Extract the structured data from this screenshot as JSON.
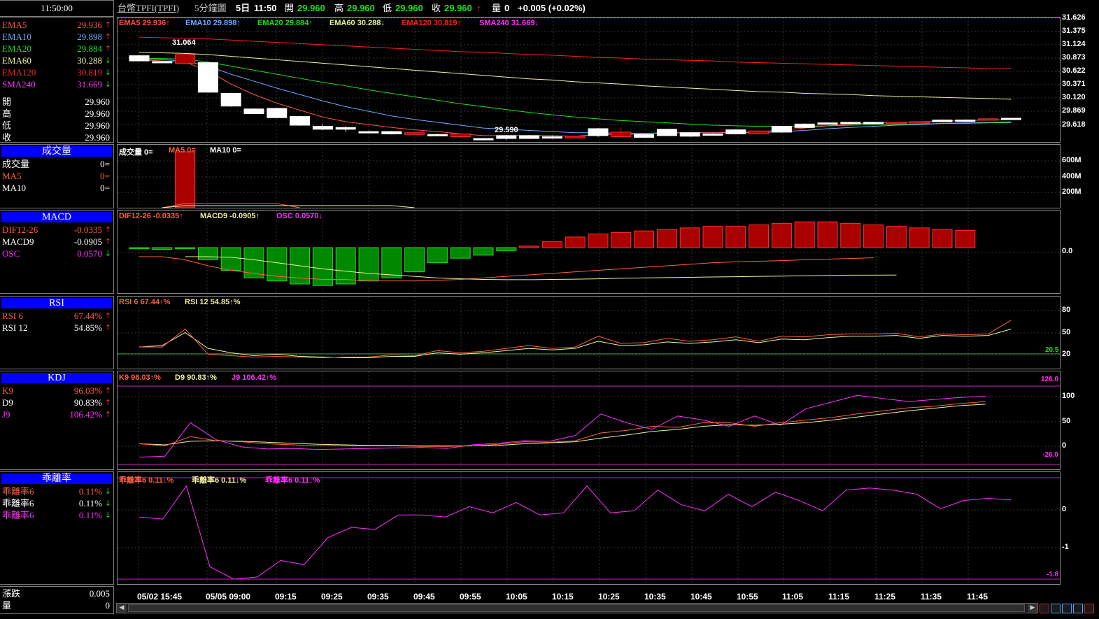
{
  "clock": "11:50:00",
  "top": {
    "symbol": "台幣TPFI(TPFI)",
    "interval": "5分鐘圖",
    "day": "5日",
    "time": "11:50",
    "open_label": "開",
    "open": "29.960",
    "high_label": "高",
    "high": "29.960",
    "low_label": "低",
    "low": "29.960",
    "close_label": "收",
    "close": "29.960",
    "close_arrow": "↑",
    "vol_label": "量",
    "vol": "0",
    "change": "+0.005 (+0.02%)"
  },
  "side": {
    "ema": [
      {
        "label": "EMA5",
        "value": "29.936",
        "arrow": "↑",
        "color": "#ff5050",
        "arrow_color": "#ff3030"
      },
      {
        "label": "EMA10",
        "value": "29.898",
        "arrow": "↑",
        "color": "#6fa8ff",
        "arrow_color": "#ff3030"
      },
      {
        "label": "EMA20",
        "value": "29.884",
        "arrow": "↑",
        "color": "#22dd22",
        "arrow_color": "#ff3030"
      },
      {
        "label": "EMA60",
        "value": "30.288",
        "arrow": "↓",
        "color": "#f0f0a0",
        "arrow_color": "#22dd22"
      },
      {
        "label": "EMA120",
        "value": "30.819",
        "arrow": "↓",
        "color": "#ff2020",
        "arrow_color": "#22dd22"
      },
      {
        "label": "SMA240",
        "value": "31.669",
        "arrow": "↓",
        "color": "#ff30ff",
        "arrow_color": "#22dd22"
      }
    ],
    "ohlc": [
      {
        "label": "開",
        "value": "29.960"
      },
      {
        "label": "高",
        "value": "29.960"
      },
      {
        "label": "低",
        "value": "29.960"
      },
      {
        "label": "收",
        "value": "29.960"
      }
    ],
    "vol_title": "成交量",
    "vol_rows": [
      {
        "label": "成交量",
        "value": "0=",
        "color": "#ffffff"
      },
      {
        "label": "MA5",
        "value": "0=",
        "color": "#ff6040"
      },
      {
        "label": "MA10",
        "value": "0=",
        "color": "#ffffff"
      }
    ],
    "macd_title": "MACD",
    "macd_rows": [
      {
        "label": "DIF12-26",
        "value": "-0.0335",
        "arrow": "↑",
        "color": "#ff6040",
        "arrow_color": "#ff3030"
      },
      {
        "label": "MACD9",
        "value": "-0.0905",
        "arrow": "↑",
        "color": "#ffffff",
        "arrow_color": "#ff3030"
      },
      {
        "label": "OSC",
        "value": "0.0570",
        "arrow": "↓",
        "color": "#ff30ff",
        "arrow_color": "#22dd22"
      }
    ],
    "rsi_title": "RSI",
    "rsi_rows": [
      {
        "label": "RSI 6",
        "value": "67.44%",
        "arrow": "↑",
        "color": "#ff6040",
        "arrow_color": "#ff3030"
      },
      {
        "label": "RSI 12",
        "value": "54.85%",
        "arrow": "↑",
        "color": "#ffffff",
        "arrow_color": "#ff3030"
      }
    ],
    "kdj_title": "KDJ",
    "kdj_rows": [
      {
        "label": "K9",
        "value": "96.03%",
        "arrow": "↑",
        "color": "#ff6040",
        "arrow_color": "#ff3030"
      },
      {
        "label": "D9",
        "value": "90.83%",
        "arrow": "↑",
        "color": "#ffffff",
        "arrow_color": "#ff3030"
      },
      {
        "label": "J9",
        "value": "106.42%",
        "arrow": "↑",
        "color": "#ff30ff",
        "arrow_color": "#ff3030"
      }
    ],
    "bias_title": "乖離率",
    "bias_rows": [
      {
        "label": "乖離率6",
        "value": "0.11%",
        "arrow": "↓",
        "color": "#ff6040",
        "arrow_color": "#22dd22"
      },
      {
        "label": "乖離率6",
        "value": "0.11%",
        "arrow": "↓",
        "color": "#ffffff",
        "arrow_color": "#22dd22"
      },
      {
        "label": "乖離率6",
        "value": "0.11%",
        "arrow": "↓",
        "color": "#ff30ff",
        "arrow_color": "#22dd22"
      }
    ],
    "bottom_rows": [
      {
        "label": "漲跌",
        "value": "0.005"
      },
      {
        "label": "量",
        "value": "0"
      }
    ]
  },
  "legends": {
    "price": [
      {
        "text": "EMA5 29.936↑",
        "color": "#ff5050"
      },
      {
        "text": "EMA10 29.898↑",
        "color": "#6fa8ff"
      },
      {
        "text": "EMA20 29.884↑",
        "color": "#22dd22"
      },
      {
        "text": "EMA60 30.288↓",
        "color": "#f0f0a0"
      },
      {
        "text": "EMA120 30.819↑",
        "color": "#ff2020"
      },
      {
        "text": "SMA240 31.669↓",
        "color": "#ff30ff"
      }
    ],
    "volume": [
      {
        "text": "成交量 0=",
        "color": "#ffffff"
      },
      {
        "text": "MA5 0=",
        "color": "#ff6040"
      },
      {
        "text": "MA10 0=",
        "color": "#ffffff"
      }
    ],
    "macd": [
      {
        "text": "DIF12-26 -0.0335↑",
        "color": "#ff6040"
      },
      {
        "text": "MACD9 -0.0905↑",
        "color": "#f0f0a0"
      },
      {
        "text": "OSC 0.0570↓",
        "color": "#ff30ff"
      }
    ],
    "rsi": [
      {
        "text": "RSI 6 67.44↑%",
        "color": "#ff6040"
      },
      {
        "text": "RSI 12 54.85↑%",
        "color": "#f0f0a0"
      }
    ],
    "kdj": [
      {
        "text": "K9 96.03↑%",
        "color": "#ff6040"
      },
      {
        "text": "D9 90.83↑%",
        "color": "#f0f0a0"
      },
      {
        "text": "J9 106.42↑%",
        "color": "#ff30ff"
      }
    ],
    "bias": [
      {
        "text": "乖離率6 0.11↓%",
        "color": "#ff6040"
      },
      {
        "text": "乖離率6 0.11↓%",
        "color": "#f0f0a0"
      },
      {
        "text": "乖離率6 0.11↓%",
        "color": "#ff30ff"
      }
    ]
  },
  "scales": {
    "price": [
      "31.626",
      "31.375",
      "31.124",
      "30.873",
      "30.622",
      "30.371",
      "30.120",
      "29.869",
      "29.618"
    ],
    "volume": [
      "600M",
      "400M",
      "200M"
    ],
    "macd": [
      "0.0"
    ],
    "rsi": [
      "80",
      "50",
      "20"
    ],
    "rsi_ref": "20.5",
    "kdj": [
      "100",
      "50",
      "0"
    ],
    "kdj_hi": "126.0",
    "kdj_lo": "-26.0",
    "bias": [
      "0",
      "-1"
    ],
    "bias_lo": "-1.8"
  },
  "annotations": {
    "high": "31.064",
    "low": "29.590"
  },
  "xaxis": [
    "05/02 15:45",
    "05/05 09:00",
    "09:15",
    "09:25",
    "09:35",
    "09:45",
    "09:55",
    "10:05",
    "10:15",
    "10:25",
    "10:35",
    "10:45",
    "10:55",
    "11:05",
    "11:15",
    "11:25",
    "11:35",
    "11:45"
  ],
  "chart_data": {
    "type": "candlestick",
    "price_range": [
      29.55,
      31.7
    ],
    "candles": [
      {
        "o": 30.95,
        "c": 31.04,
        "h": 31.05,
        "l": 30.95
      },
      {
        "o": 30.93,
        "c": 30.94,
        "h": 30.95,
        "l": 30.92
      },
      {
        "o": 31.06,
        "c": 30.91,
        "h": 31.064,
        "l": 30.89
      },
      {
        "o": 30.41,
        "c": 30.92,
        "h": 30.93,
        "l": 30.4
      },
      {
        "o": 30.17,
        "c": 30.39,
        "h": 30.4,
        "l": 30.16
      },
      {
        "o": 30.04,
        "c": 30.12,
        "h": 30.13,
        "l": 30.03
      },
      {
        "o": 29.97,
        "c": 30.13,
        "h": 30.14,
        "l": 29.96
      },
      {
        "o": 29.84,
        "c": 29.99,
        "h": 30.0,
        "l": 29.83
      },
      {
        "o": 29.77,
        "c": 29.82,
        "h": 29.85,
        "l": 29.76
      },
      {
        "o": 29.77,
        "c": 29.8,
        "h": 29.82,
        "l": 29.73
      },
      {
        "o": 29.71,
        "c": 29.73,
        "h": 29.74,
        "l": 29.7
      },
      {
        "o": 29.69,
        "c": 29.73,
        "h": 29.74,
        "l": 29.68
      },
      {
        "o": 29.71,
        "c": 29.68,
        "h": 29.73,
        "l": 29.67
      },
      {
        "o": 29.66,
        "c": 29.68,
        "h": 29.69,
        "l": 29.65
      },
      {
        "o": 29.69,
        "c": 29.64,
        "h": 29.7,
        "l": 29.63
      },
      {
        "o": 29.6,
        "c": 29.61,
        "h": 29.62,
        "l": 29.59
      },
      {
        "o": 29.61,
        "c": 29.66,
        "h": 29.67,
        "l": 29.59
      },
      {
        "o": 29.61,
        "c": 29.66,
        "h": 29.67,
        "l": 29.6
      },
      {
        "o": 29.63,
        "c": 29.64,
        "h": 29.66,
        "l": 29.6
      },
      {
        "o": 29.65,
        "c": 29.62,
        "h": 29.66,
        "l": 29.61
      },
      {
        "o": 29.66,
        "c": 29.78,
        "h": 29.79,
        "l": 29.64
      },
      {
        "o": 29.72,
        "c": 29.64,
        "h": 29.8,
        "l": 29.63
      },
      {
        "o": 29.63,
        "c": 29.68,
        "h": 29.7,
        "l": 29.62
      },
      {
        "o": 29.66,
        "c": 29.77,
        "h": 29.78,
        "l": 29.65
      },
      {
        "o": 29.65,
        "c": 29.71,
        "h": 29.72,
        "l": 29.64
      },
      {
        "o": 29.68,
        "c": 29.69,
        "h": 29.7,
        "l": 29.67
      },
      {
        "o": 29.69,
        "c": 29.76,
        "h": 29.77,
        "l": 29.68
      },
      {
        "o": 29.74,
        "c": 29.69,
        "h": 29.75,
        "l": 29.68
      },
      {
        "o": 29.72,
        "c": 29.82,
        "h": 29.83,
        "l": 29.71
      },
      {
        "o": 29.8,
        "c": 29.86,
        "h": 29.87,
        "l": 29.79
      },
      {
        "o": 29.86,
        "c": 29.88,
        "h": 29.89,
        "l": 29.85
      },
      {
        "o": 29.87,
        "c": 29.89,
        "h": 29.9,
        "l": 29.86
      },
      {
        "o": 29.89,
        "c": 29.89,
        "h": 29.9,
        "l": 29.88
      },
      {
        "o": 29.89,
        "c": 29.88,
        "h": 29.9,
        "l": 29.87
      },
      {
        "o": 29.9,
        "c": 29.89,
        "h": 29.91,
        "l": 29.88
      },
      {
        "o": 29.9,
        "c": 29.93,
        "h": 29.94,
        "l": 29.89
      },
      {
        "o": 29.93,
        "c": 29.93,
        "h": 29.94,
        "l": 29.92
      },
      {
        "o": 29.95,
        "c": 29.94,
        "h": 29.96,
        "l": 29.94
      },
      {
        "o": 29.94,
        "c": 29.96,
        "h": 29.96,
        "l": 29.94
      }
    ],
    "ema5": [
      30.97,
      30.95,
      30.93,
      30.78,
      30.55,
      30.37,
      30.22,
      30.1,
      29.98,
      29.9,
      29.85,
      29.8,
      29.76,
      29.73,
      29.69,
      29.66,
      29.66,
      29.66,
      29.66,
      29.65,
      29.68,
      29.68,
      29.69,
      29.71,
      29.71,
      29.71,
      29.72,
      29.72,
      29.76,
      29.79,
      29.83,
      29.86,
      29.88,
      29.89,
      29.9,
      29.91,
      29.92,
      29.93,
      29.936
    ],
    "ema10": [
      30.98,
      30.97,
      30.95,
      30.86,
      30.72,
      30.6,
      30.48,
      30.37,
      30.26,
      30.16,
      30.08,
      30.0,
      29.94,
      29.89,
      29.84,
      29.79,
      29.77,
      29.75,
      29.73,
      29.71,
      29.71,
      29.7,
      29.7,
      29.71,
      29.71,
      29.71,
      29.71,
      29.71,
      29.73,
      29.75,
      29.78,
      29.8,
      29.82,
      29.84,
      29.85,
      29.87,
      29.88,
      29.89,
      29.898
    ],
    "ema20": [
      31.0,
      30.99,
      30.98,
      30.93,
      30.86,
      30.79,
      30.72,
      30.65,
      30.58,
      30.52,
      30.45,
      30.39,
      30.33,
      30.27,
      30.21,
      30.16,
      30.11,
      30.06,
      30.02,
      29.98,
      29.95,
      29.92,
      29.9,
      29.88,
      29.86,
      29.84,
      29.83,
      29.82,
      29.82,
      29.82,
      29.83,
      29.84,
      29.85,
      29.85,
      29.86,
      29.87,
      29.87,
      29.88,
      29.884
    ],
    "ema60": [
      31.1,
      31.09,
      31.08,
      31.06,
      31.03,
      31.0,
      30.97,
      30.94,
      30.91,
      30.88,
      30.85,
      30.82,
      30.79,
      30.76,
      30.73,
      30.7,
      30.67,
      30.64,
      30.62,
      30.59,
      30.57,
      30.55,
      30.52,
      30.5,
      30.48,
      30.46,
      30.44,
      30.42,
      30.41,
      30.39,
      30.38,
      30.37,
      30.35,
      30.34,
      30.33,
      30.32,
      30.31,
      30.3,
      30.288
    ],
    "ema120": [
      31.36,
      31.35,
      31.34,
      31.33,
      31.31,
      31.29,
      31.27,
      31.25,
      31.23,
      31.21,
      31.19,
      31.17,
      31.15,
      31.13,
      31.11,
      31.1,
      31.08,
      31.06,
      31.05,
      31.03,
      31.01,
      31.0,
      30.98,
      30.97,
      30.96,
      30.95,
      30.93,
      30.92,
      30.91,
      30.9,
      30.89,
      30.88,
      30.87,
      30.86,
      30.85,
      30.84,
      30.83,
      30.82,
      30.819
    ],
    "volume_bars": [
      {
        "index": 2,
        "value": 800
      }
    ],
    "volume_range": [
      0,
      800
    ],
    "osc": [
      -0.004,
      -0.006,
      -0.004,
      -0.04,
      -0.075,
      -0.1,
      -0.11,
      -0.12,
      -0.125,
      -0.12,
      -0.11,
      -0.1,
      -0.08,
      -0.05,
      -0.035,
      -0.025,
      -0.01,
      0.005,
      0.02,
      0.035,
      0.045,
      0.05,
      0.055,
      0.06,
      0.065,
      0.07,
      0.07,
      0.075,
      0.08,
      0.085,
      0.085,
      0.08,
      0.075,
      0.07,
      0.065,
      0.06,
      0.057
    ],
    "macd_range": [
      -0.15,
      0.12
    ],
    "dif": [
      -0.03,
      -0.03,
      -0.04,
      -0.06,
      -0.075,
      -0.085,
      -0.095,
      -0.1,
      -0.105,
      -0.105,
      -0.11,
      -0.11,
      -0.11,
      -0.108,
      -0.105,
      -0.1,
      -0.095,
      -0.09,
      -0.085,
      -0.08,
      -0.075,
      -0.07,
      -0.065,
      -0.06,
      -0.055,
      -0.05,
      -0.047,
      -0.045,
      -0.043,
      -0.04,
      -0.038,
      -0.036,
      -0.0335
    ],
    "macd9": [
      -0.03,
      -0.03,
      -0.032,
      -0.04,
      -0.05,
      -0.06,
      -0.07,
      -0.078,
      -0.085,
      -0.09,
      -0.095,
      -0.1,
      -0.103,
      -0.105,
      -0.106,
      -0.106,
      -0.105,
      -0.104,
      -0.103,
      -0.101,
      -0.1,
      -0.099,
      -0.098,
      -0.097,
      -0.096,
      -0.095,
      -0.094,
      -0.093,
      -0.092,
      -0.091,
      -0.091,
      -0.0905
    ],
    "rsi6": [
      30,
      30,
      55,
      20,
      18,
      16,
      17,
      16,
      15,
      16,
      16,
      19,
      18,
      25,
      22,
      24,
      28,
      32,
      28,
      30,
      45,
      35,
      36,
      42,
      38,
      40,
      44,
      38,
      45,
      44,
      47,
      48,
      48,
      49,
      44,
      48,
      47,
      48,
      67.44
    ],
    "rsi12": [
      30,
      32,
      50,
      28,
      22,
      18,
      20,
      17,
      16,
      15,
      15,
      17,
      17,
      22,
      20,
      22,
      25,
      28,
      26,
      28,
      38,
      32,
      33,
      37,
      35,
      37,
      40,
      36,
      41,
      40,
      43,
      45,
      45,
      46,
      42,
      46,
      45,
      46,
      54.85
    ],
    "rsi_ref": 20.5,
    "k9": [
      14,
      10,
      28,
      20,
      18,
      14,
      12,
      10,
      10,
      10,
      10,
      9,
      9,
      10,
      13,
      18,
      17,
      20,
      35,
      40,
      48,
      46,
      55,
      55,
      48,
      55,
      60,
      65,
      72,
      78,
      84,
      87,
      92,
      96.03
    ],
    "d9": [
      14,
      12,
      19,
      20,
      19,
      17,
      15,
      13,
      12,
      11,
      11,
      10,
      10,
      10,
      11,
      14,
      16,
      18,
      25,
      31,
      38,
      42,
      48,
      51,
      50,
      52,
      55,
      60,
      66,
      72,
      78,
      83,
      88,
      90.83
    ],
    "j9": [
      -12,
      -10,
      55,
      22,
      8,
      4,
      5,
      3,
      4,
      5,
      6,
      7,
      5,
      12,
      15,
      20,
      19,
      30,
      72,
      55,
      42,
      68,
      60,
      48,
      68,
      50,
      82,
      95,
      108,
      102,
      96,
      100,
      104,
      106.42
    ],
    "kdj_range": [
      -26,
      126
    ],
    "bias": [
      -0.3,
      -0.35,
      0.45,
      -1.5,
      -1.8,
      -1.75,
      -1.35,
      -1.45,
      -0.8,
      -0.55,
      -0.6,
      -0.25,
      -0.25,
      -0.3,
      -0.05,
      -0.2,
      0.05,
      -0.25,
      -0.2,
      0.45,
      -0.2,
      -0.15,
      0.35,
      0.0,
      -0.15,
      0.25,
      -0.05,
      0.3,
      0.1,
      -0.15,
      0.35,
      0.4,
      0.35,
      0.25,
      -0.1,
      0.1,
      0.15,
      0.11
    ],
    "bias_range": [
      -1.8,
      0.7
    ]
  }
}
